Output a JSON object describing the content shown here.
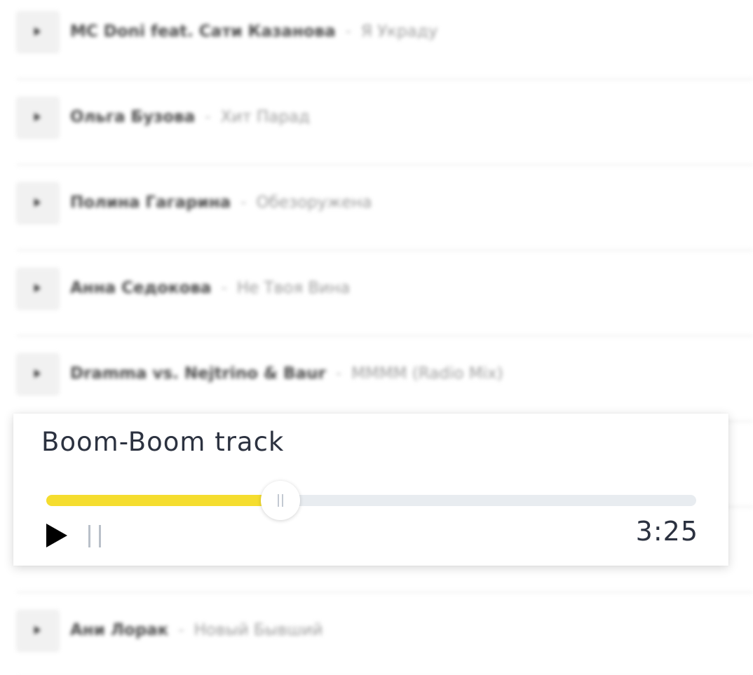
{
  "playlist": {
    "tracks": [
      {
        "artist": "MC Doni feat. Сати Казанова",
        "separator": "-",
        "title": "Я Украду"
      },
      {
        "artist": "Ольга Бузова",
        "separator": "-",
        "title": "Хит Парад"
      },
      {
        "artist": "Полина Гагарина",
        "separator": "-",
        "title": "Обезоружена"
      },
      {
        "artist": "Анна Седокова",
        "separator": "-",
        "title": "Не Твоя Вина"
      },
      {
        "artist": "Dramma vs. Nejtrino & Baur",
        "separator": "-",
        "title": "MMMM (Radio Mix)"
      },
      {
        "artist": "Ани Лорак",
        "separator": "-",
        "title": "Новый Бывший"
      }
    ]
  },
  "player": {
    "title": "Boom-Boom track",
    "time": "3:25",
    "progress_fraction": 0.36,
    "colors": {
      "progress_fill": "#f5dd2e",
      "progress_track": "#e8ecf0",
      "text": "#2c3240"
    },
    "icons": {
      "play": "play-icon",
      "pause": "pause-icon"
    }
  }
}
